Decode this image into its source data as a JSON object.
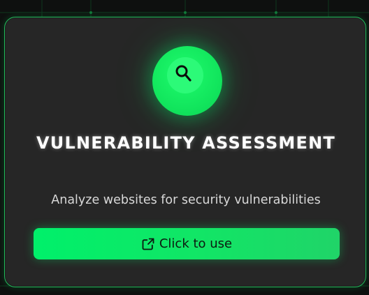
{
  "card": {
    "title": "Vulnerability Assessment",
    "description": "Analyze websites for security vulnerabilities",
    "icon": "magnifier-icon",
    "cta_label": "Click to use",
    "cta_icon": "external-link-icon"
  },
  "colors": {
    "accent": "#11e45c",
    "card_bg": "#262626",
    "border": "#23b85a",
    "page_bg": "#0e100f"
  }
}
